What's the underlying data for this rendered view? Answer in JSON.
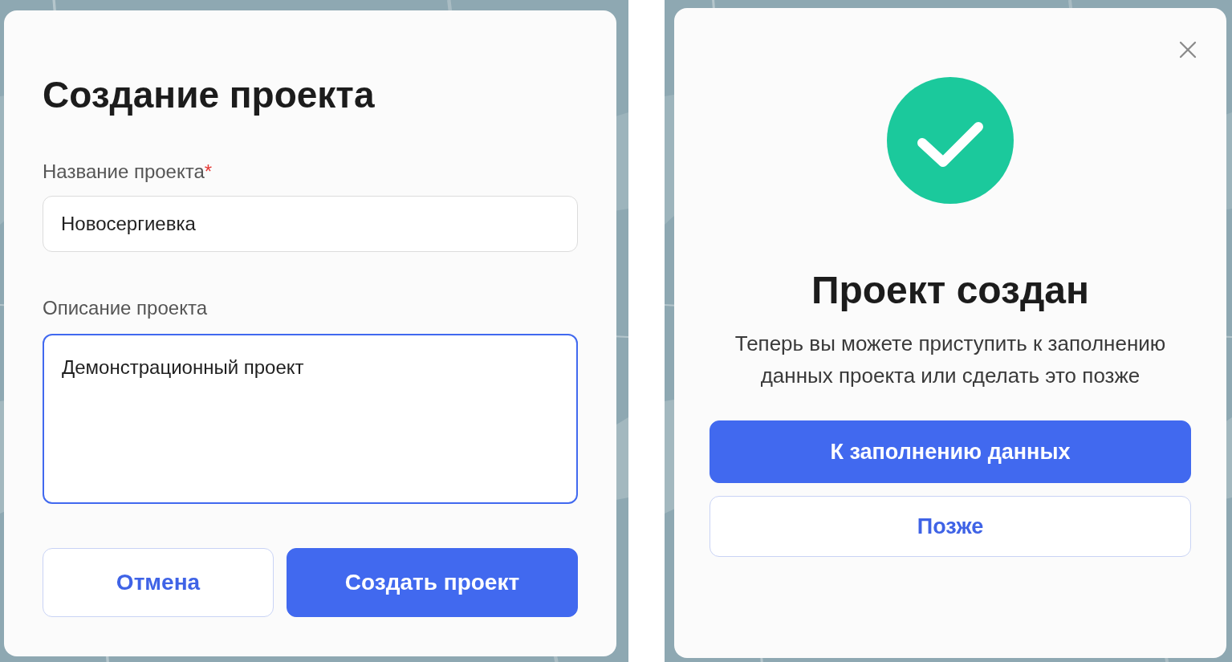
{
  "create_dialog": {
    "title": "Создание проекта",
    "name_field": {
      "label": "Название проекта",
      "required_mark": "*",
      "value": "Новосергиевка",
      "focused": false
    },
    "description_field": {
      "label": "Описание проекта",
      "value": "Демонстрационный проект",
      "focused": true
    },
    "buttons": [
      {
        "label": "Отмена",
        "kind": "secondary"
      },
      {
        "label": "Создать проект",
        "kind": "primary"
      }
    ]
  },
  "success_dialog": {
    "title": "Проект создан",
    "message": "Теперь вы можете приступить к заполнению данных проекта или сделать это позже",
    "buttons": [
      {
        "label": "К заполнению данных",
        "kind": "primary"
      },
      {
        "label": "Позже",
        "kind": "secondary"
      }
    ]
  }
}
